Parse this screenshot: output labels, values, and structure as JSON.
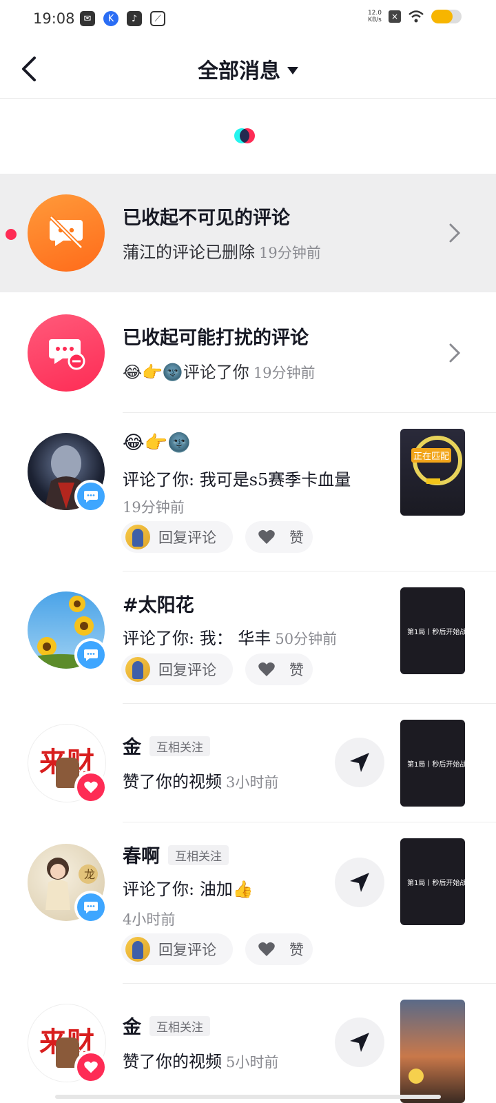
{
  "status_bar": {
    "time": "19:08",
    "speed_value": "12.0",
    "speed_unit": "KB/s",
    "battery_level_percent": 70,
    "icons": [
      "mail-icon",
      "k-app-icon",
      "tiktok-icon",
      "leaf-icon",
      "close-box-icon",
      "wifi-icon",
      "battery-icon"
    ]
  },
  "header": {
    "title": "全部消息",
    "back_icon": "chevron-left-icon",
    "dropdown_icon": "caret-down-icon"
  },
  "system_rows": [
    {
      "title": "已收起不可见的评论",
      "subtitle": "蒲江的评论已删除",
      "time": "19分钟前",
      "unread": true,
      "icon": "hidden-comment-icon",
      "color": "#ff7a1a"
    },
    {
      "title": "已收起可能打扰的评论",
      "subtitle_emoji": "😂👉🌚",
      "subtitle": "评论了你",
      "time": "19分钟前",
      "unread": false,
      "icon": "muted-comment-icon",
      "color": "#fe2c55"
    }
  ],
  "notifications": [
    {
      "name_emoji": "😂👉🌚",
      "text": "评论了你: 我可是s5赛季卡血量",
      "time": "19分钟前",
      "badge": "comment",
      "reply_label": "回复评论",
      "like_label": "赞",
      "thumb_caption": "正在匹配"
    },
    {
      "name": "#太阳花",
      "text": "评论了你: 我： 华丰",
      "time": "50分钟前",
      "badge": "comment",
      "reply_label": "回复评论",
      "like_label": "赞",
      "thumb_caption": "第1局丨秒后开始战斗!"
    },
    {
      "name": "金",
      "mutual": "互相关注",
      "text": "赞了你的视频",
      "time": "3小时前",
      "badge": "like",
      "avatar_text": "来财",
      "thumb_caption": "第1局丨秒后开始战斗!"
    },
    {
      "name": "春啊",
      "mutual": "互相关注",
      "text": "评论了你: 油加",
      "text_emoji": "👍",
      "time": "4小时前",
      "badge": "comment",
      "reply_label": "回复评论",
      "like_label": "赞",
      "thumb_caption": "第1局丨秒后开始战斗!"
    },
    {
      "name": "金",
      "mutual": "互相关注",
      "text": "赞了你的视频",
      "time": "5小时前",
      "badge": "like",
      "avatar_text": "来财"
    }
  ],
  "colors": {
    "accent_red": "#fe2c55",
    "accent_orange": "#ff7a1a",
    "comment_badge": "#3ea6ff",
    "text_primary": "#161823",
    "text_secondary": "#8a8b91"
  }
}
